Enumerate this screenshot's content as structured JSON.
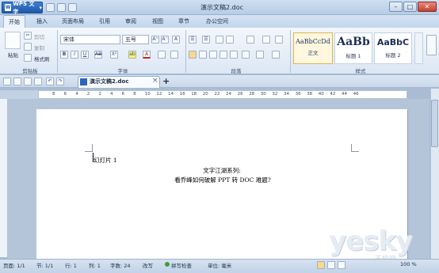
{
  "app": {
    "name": "WPS 文字",
    "logo": "W"
  },
  "window": {
    "title": "演示文稿2.doc",
    "minimize": "–",
    "maximize": "□",
    "close": "✕"
  },
  "tabs": [
    {
      "label": "开始",
      "active": true
    },
    {
      "label": "插入"
    },
    {
      "label": "页面布局"
    },
    {
      "label": "引用"
    },
    {
      "label": "审阅"
    },
    {
      "label": "视图"
    },
    {
      "label": "章节"
    },
    {
      "label": "办公空间"
    }
  ],
  "ribbon": {
    "clipboard": {
      "paste": "粘贴",
      "cut": "剪切",
      "copy": "复制",
      "format_painter": "格式刷",
      "group": "剪贴板"
    },
    "font": {
      "family": "宋体",
      "size": "五号",
      "group": "字体",
      "grow": "A⁺",
      "shrink": "A⁻",
      "clear": "A",
      "bold": "B",
      "italic": "I",
      "underline": "U",
      "strike": "AB",
      "superscript": "X²",
      "highlight": "ab",
      "color": "A"
    },
    "paragraph": {
      "group": "段落"
    },
    "styles": {
      "group": "样式",
      "items": [
        {
          "preview": "AaBbCcDd",
          "name": "正文"
        },
        {
          "preview": "AaBb",
          "name": "标题 1"
        },
        {
          "preview": "AaBbC",
          "name": "标题 2"
        }
      ]
    }
  },
  "document_tab": {
    "label": "演示文稿2.doc",
    "close": "×",
    "add": "+"
  },
  "ruler": {
    "ticks": [
      "8",
      "6",
      "4",
      "2",
      "2",
      "4",
      "6",
      "8",
      "10",
      "12",
      "14",
      "16",
      "18",
      "20",
      "22",
      "24",
      "26",
      "28",
      "30",
      "32",
      "34",
      "36",
      "38",
      "40",
      "42",
      "44",
      "46"
    ]
  },
  "document": {
    "line1": "幻灯片 1",
    "heading1": "文字江湖系列:",
    "heading2": "看乔峰如何破解 PPT 转 DOC 难题?"
  },
  "status": {
    "page": "页面: 1/1",
    "section": "节: 1/1",
    "row": "行: 1",
    "col": "列: 1",
    "words": "字数: 24",
    "overwrite": "改写",
    "spellcheck": "拼写检查",
    "unit": "单位: 毫米",
    "zoom": "100 %"
  },
  "watermark": {
    "brand": "yesky",
    "sub": "天极网"
  },
  "colors": {
    "accent": "#1f58a8",
    "ribbon_bg": "#dce7f4",
    "page_bg": "#ffffff"
  }
}
